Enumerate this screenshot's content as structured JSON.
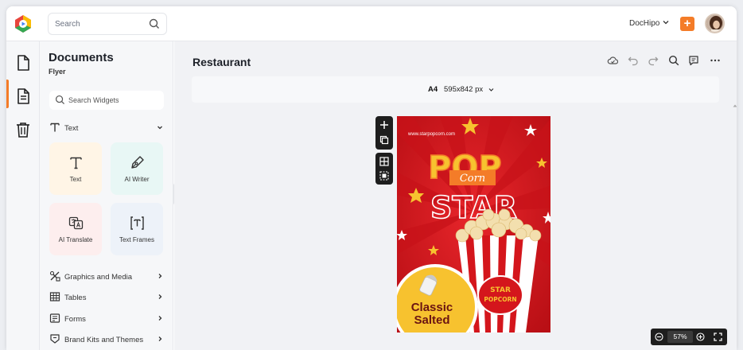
{
  "topbar": {
    "search_placeholder": "Search",
    "brand": "DocHipo",
    "icons": [
      "logo-icon",
      "search-icon",
      "chevron-down-icon",
      "plus-icon",
      "avatar"
    ],
    "accent": "#f47c28"
  },
  "rail": {
    "items": [
      "document-icon",
      "page-icon",
      "trash-icon"
    ],
    "active_index": 1
  },
  "panel": {
    "title": "Documents",
    "subtitle": "Flyer",
    "search_placeholder": "Search Widgets",
    "text_section": "Text",
    "tiles": [
      {
        "label": "Text",
        "icon": "text-icon",
        "bg": "#fff5e6"
      },
      {
        "label": "AI Writer",
        "icon": "pen-nib-icon",
        "bg": "#e8f7f5"
      },
      {
        "label": "AI Translate",
        "icon": "translate-icon",
        "bg": "#fdeeee"
      },
      {
        "label": "Text Frames",
        "icon": "text-frame-icon",
        "bg": "#edf2f9"
      }
    ],
    "sections": [
      {
        "label": "Graphics and Media",
        "icon": "graphics-icon"
      },
      {
        "label": "Tables",
        "icon": "table-icon"
      },
      {
        "label": "Forms",
        "icon": "form-icon"
      },
      {
        "label": "Brand Kits and Themes",
        "icon": "brand-kit-icon"
      }
    ]
  },
  "main": {
    "doc_title": "Restaurant",
    "page_size": {
      "name": "A4",
      "dims": "595x842 px"
    },
    "toolbar_icons": [
      "cloud-icon",
      "undo-icon",
      "redo-icon",
      "search-icon",
      "comment-icon",
      "more-icon"
    ],
    "zoom": "57%"
  },
  "poster": {
    "url": "www.starpopcorn.com",
    "pop": "POP",
    "corn": "Corn",
    "star": "STAR",
    "badge_top": "STAR",
    "badge_bottom": "POPCORN",
    "classic": "Classic",
    "salted": "Salted",
    "colors": {
      "red": "#d4161c",
      "yellow": "#f7c22f",
      "orange": "#f47c28"
    }
  }
}
